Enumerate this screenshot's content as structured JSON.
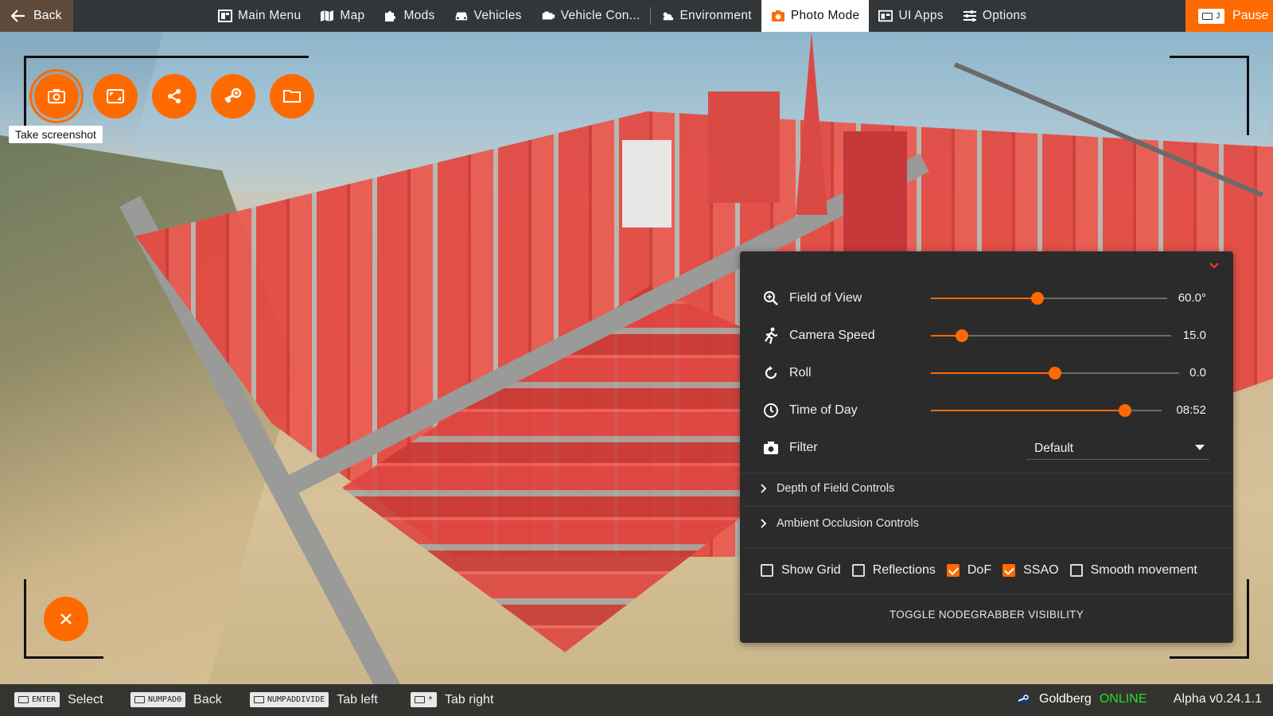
{
  "topbar": {
    "back_label": "Back",
    "items": [
      {
        "label": "Main Menu",
        "icon": "main-menu-icon"
      },
      {
        "label": "Map",
        "icon": "map-icon"
      },
      {
        "label": "Mods",
        "icon": "puzzle-icon"
      },
      {
        "label": "Vehicles",
        "icon": "car-icon"
      },
      {
        "label": "Vehicle Con...",
        "icon": "vehicle-config-icon"
      },
      {
        "label": "Environment",
        "icon": "weather-icon"
      },
      {
        "label": "Photo Mode",
        "icon": "camera-icon",
        "active": true
      },
      {
        "label": "UI Apps",
        "icon": "ui-apps-icon"
      },
      {
        "label": "Options",
        "icon": "sliders-icon"
      }
    ],
    "pause_label": "Pause"
  },
  "photo_tools": {
    "buttons": [
      "camera-icon",
      "frame-icon",
      "share-icon",
      "steam-icon",
      "folder-icon"
    ],
    "tooltip": "Take screenshot"
  },
  "settings": {
    "sliders": [
      {
        "label": "Field of View",
        "value": "60.0°",
        "level": 0.45,
        "icon": "zoom-icon"
      },
      {
        "label": "Camera Speed",
        "value": "15.0",
        "level": 0.13,
        "icon": "running-icon"
      },
      {
        "label": "Roll",
        "value": "0.0",
        "level": 0.5,
        "icon": "rotate-icon"
      },
      {
        "label": "Time of Day",
        "value": "08:52",
        "level": 0.84,
        "icon": "clock-icon"
      }
    ],
    "filter": {
      "label": "Filter",
      "value": "Default",
      "icon": "camera-icon"
    },
    "expanders": [
      "Depth of Field Controls",
      "Ambient Occlusion Controls"
    ],
    "checkboxes": [
      {
        "label": "Show Grid",
        "checked": false
      },
      {
        "label": "Reflections",
        "checked": false
      },
      {
        "label": "DoF",
        "checked": true
      },
      {
        "label": "SSAO",
        "checked": true
      },
      {
        "label": "Smooth movement",
        "checked": false
      }
    ],
    "toggle_button": "TOGGLE NODEGRABBER VISIBILITY"
  },
  "bottombar": {
    "hints": [
      {
        "key": "ENTER",
        "action": "Select"
      },
      {
        "key": "NUMPAD0",
        "action": "Back"
      },
      {
        "key": "NUMPADDIVIDE",
        "action": "Tab left"
      },
      {
        "key": "*",
        "action": "Tab right"
      }
    ],
    "username": "Goldberg",
    "status": "ONLINE",
    "version": "Alpha v0.24.1.1"
  },
  "colors": {
    "accent": "#ff6a00",
    "panel": "#2b2b2b",
    "online": "#22e022"
  }
}
